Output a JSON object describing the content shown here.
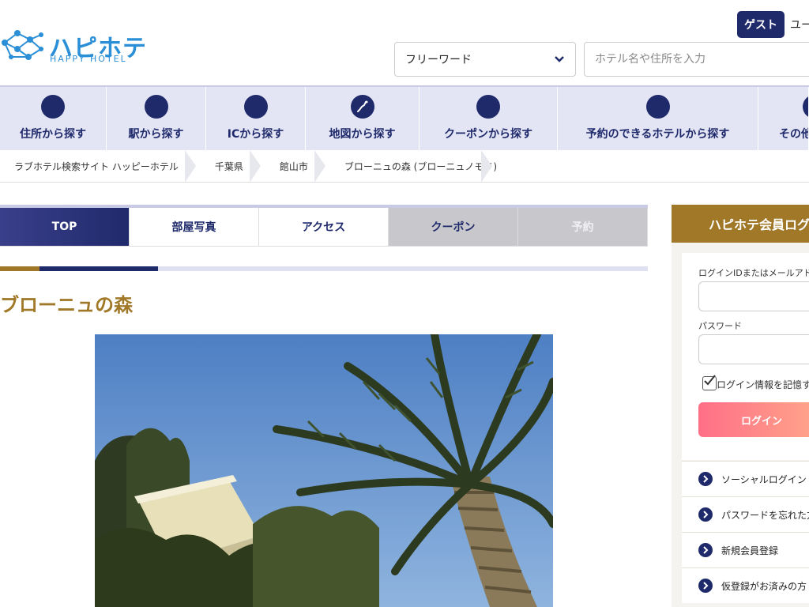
{
  "header": {
    "logo_text": "ハピホテ",
    "logo_sub": "HAPPY HOTEL",
    "guest_label": "ゲスト",
    "user_link": "ユー",
    "search_select_value": "フリーワード",
    "search_placeholder": "ホテル名や住所を入力"
  },
  "nav": {
    "items": [
      {
        "label": "住所から探す"
      },
      {
        "label": "駅から探す"
      },
      {
        "label": "ICから探す"
      },
      {
        "label": "地図から探す"
      },
      {
        "label": "クーポンから探す"
      },
      {
        "label": "予約のできるホテルから探す"
      },
      {
        "label": "その他"
      }
    ]
  },
  "breadcrumb": {
    "items": [
      "ラブホテル検索サイト ハッピーホテル",
      "千葉県",
      "館山市",
      "ブローニュの森 (ブローニュノモリ)"
    ]
  },
  "tabs": [
    {
      "label": "TOP"
    },
    {
      "label": "部屋写真"
    },
    {
      "label": "アクセス"
    },
    {
      "label": "クーポン"
    },
    {
      "label": "予約"
    }
  ],
  "hotel": {
    "name": "ブローニュの森"
  },
  "sidebar": {
    "title": "ハピホテ会員ログ",
    "id_label": "ログインIDまたはメールアドレ",
    "password_label": "パスワード",
    "remember_label": "ログイン情報を記憶す",
    "login_button": "ログイン",
    "links": [
      {
        "label": "ソーシャルログイン"
      },
      {
        "label": "パスワードを忘れた方"
      },
      {
        "label": "新規会員登録"
      },
      {
        "label": "仮登録がお済みの方"
      }
    ]
  },
  "colors": {
    "navy": "#1f2a6b",
    "gold": "#a07828",
    "nav_bg": "#e3e4f4",
    "logo_blue": "#2a8fd6"
  }
}
